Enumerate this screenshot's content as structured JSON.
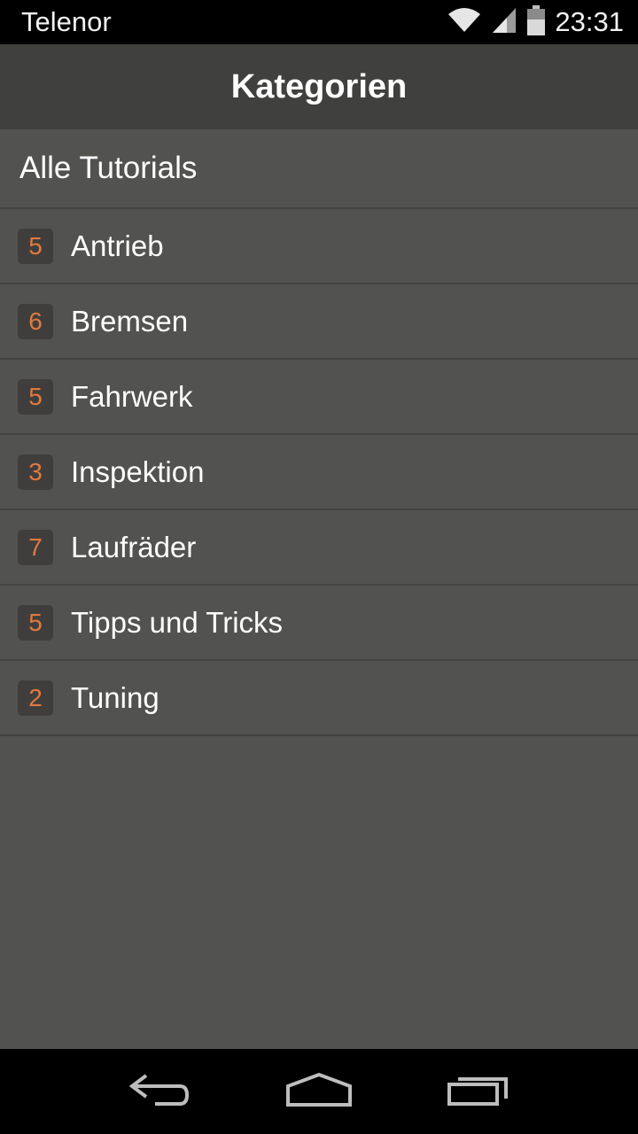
{
  "status_bar": {
    "carrier": "Telenor",
    "time": "23:31",
    "icons": [
      "wifi-icon",
      "signal-icon",
      "battery-icon"
    ]
  },
  "action_bar": {
    "title": "Kategorien"
  },
  "list": {
    "all_label": "Alle Tutorials",
    "categories": [
      {
        "count": "5",
        "label": "Antrieb"
      },
      {
        "count": "6",
        "label": "Bremsen"
      },
      {
        "count": "5",
        "label": "Fahrwerk"
      },
      {
        "count": "3",
        "label": "Inspektion"
      },
      {
        "count": "7",
        "label": "Laufräder"
      },
      {
        "count": "5",
        "label": "Tipps und Tricks"
      },
      {
        "count": "2",
        "label": "Tuning"
      }
    ]
  },
  "nav_bar": {
    "icons": [
      "back-icon",
      "home-icon",
      "recent-apps-icon"
    ]
  },
  "colors": {
    "background": "#525251",
    "action_bar": "#40403f",
    "badge_background": "#3f3e3c",
    "badge_text": "#e07a3f"
  }
}
